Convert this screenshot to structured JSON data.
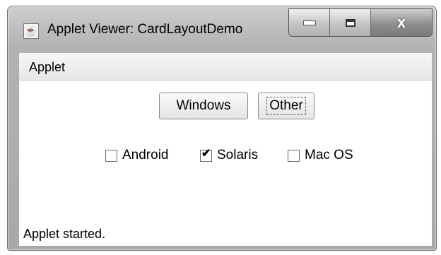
{
  "window": {
    "title": "Applet Viewer: CardLayoutDemo",
    "app_icon": "java-icon",
    "controls": {
      "minimize_icon": "minimize-icon",
      "maximize_icon": "maximize-icon",
      "close_icon": "close-icon",
      "close_glyph": "x"
    }
  },
  "menubar": {
    "items": [
      {
        "label": "Applet"
      }
    ]
  },
  "buttons": {
    "windows_label": "Windows",
    "other_label": "Other"
  },
  "checkboxes": [
    {
      "label": "Android",
      "checked": false
    },
    {
      "label": "Solaris",
      "checked": true
    },
    {
      "label": "Mac OS",
      "checked": false
    }
  ],
  "check_glyph": "✔",
  "status": {
    "text": "Applet started."
  }
}
